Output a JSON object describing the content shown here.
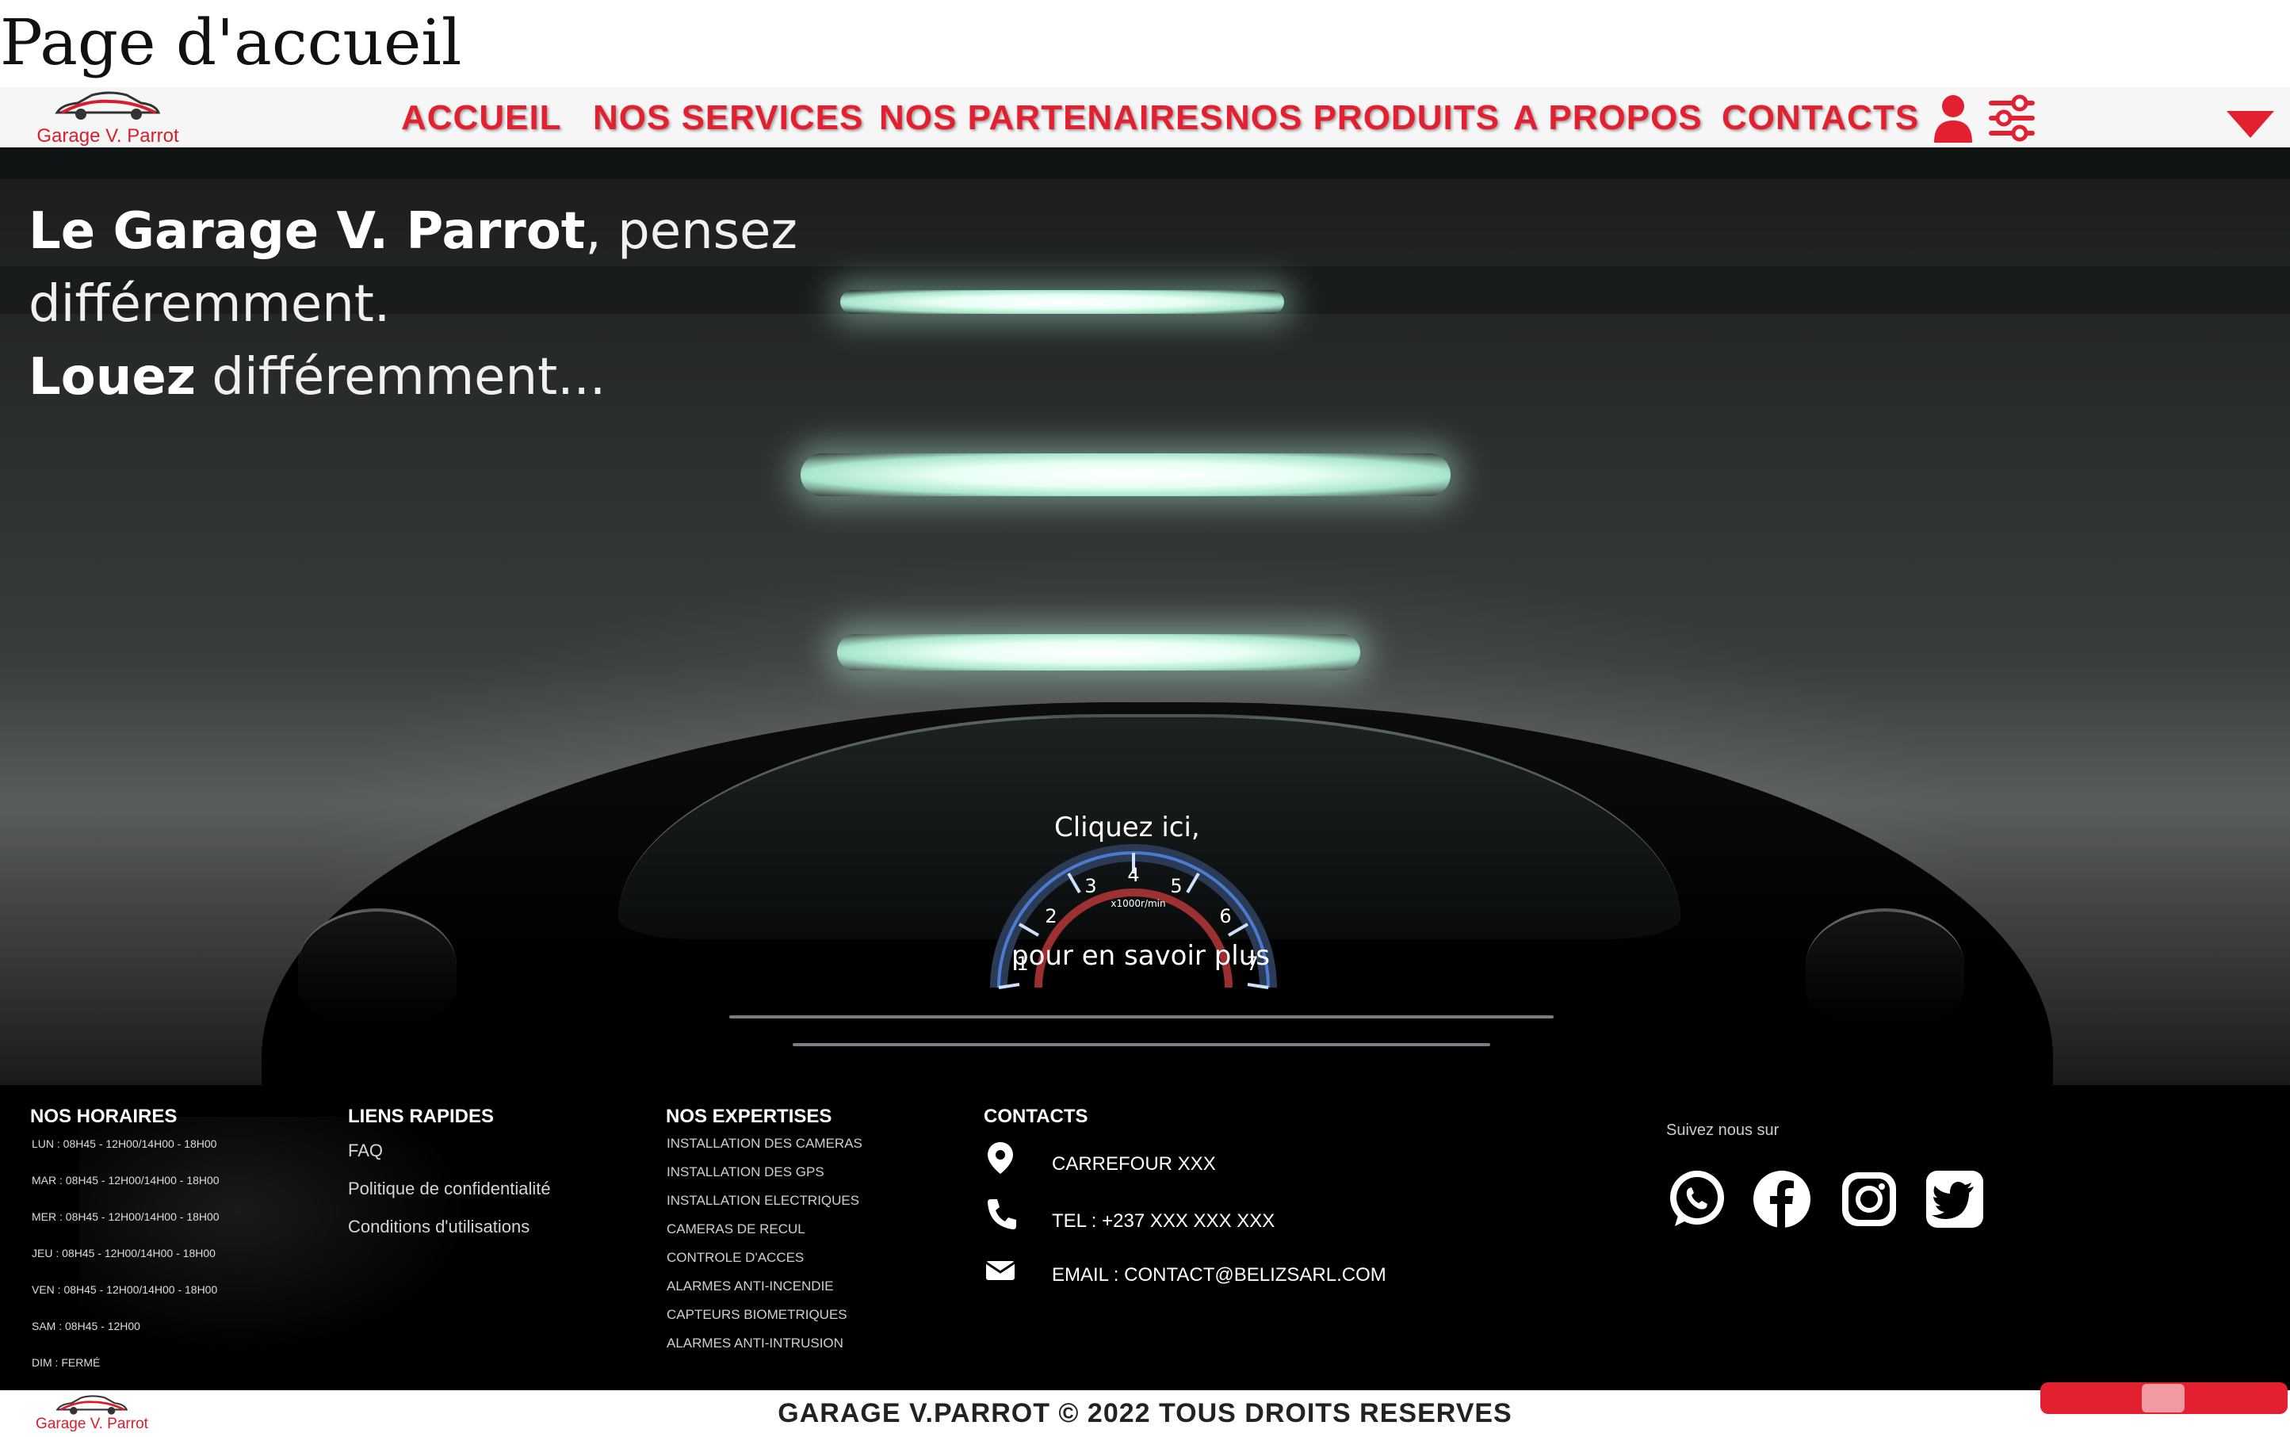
{
  "page_title": "Page d'accueil",
  "brand": {
    "logo_text": "Garage V. Parrot",
    "accent": "#e3202f"
  },
  "nav": {
    "items": [
      {
        "label": "ACCUEIL"
      },
      {
        "label": "NOS SERVICES"
      },
      {
        "label": "NOS PARTENAIRES"
      },
      {
        "label": "NOS PRODUITS"
      },
      {
        "label": "A PROPOS"
      },
      {
        "label": "CONTACTS"
      }
    ],
    "icons": [
      "user-icon",
      "settings-sliders-icon",
      "dropdown-triangle-icon"
    ]
  },
  "hero": {
    "line1_bold": "Le Garage V. Parrot",
    "line1_rest": ", pensez",
    "line2": "différemment.",
    "line3_bold": "Louez",
    "line3_rest": " différemment...",
    "cta_top": "Cliquez ici,",
    "cta_bottom": "pour en savoir plus",
    "gauge_numbers": [
      "1",
      "2",
      "3",
      "4",
      "5",
      "6",
      "7"
    ],
    "gauge_unit": "x1000r/min"
  },
  "footer": {
    "hours": {
      "title": "NOS HORAIRES",
      "rows": [
        "LUN  : 08H45 - 12H00/14H00 - 18H00",
        "MAR : 08H45 - 12H00/14H00 - 18H00",
        "MER : 08H45 - 12H00/14H00 - 18H00",
        "JEU  : 08H45 - 12H00/14H00 - 18H00",
        "VEN  : 08H45 - 12H00/14H00 - 18H00",
        "SAM : 08H45 - 12H00",
        "DIM  : FERMÉ"
      ]
    },
    "quick_links": {
      "title": "LIENS RAPIDES",
      "items": [
        "FAQ",
        "Politique de confidentialité",
        "Conditions d'utilisations"
      ]
    },
    "expertise": {
      "title": "NOS EXPERTISES",
      "items": [
        "INSTALLATION DES CAMERAS",
        "INSTALLATION DES GPS",
        "INSTALLATION ELECTRIQUES",
        "CAMERAS DE RECUL",
        "CONTROLE D'ACCES",
        "ALARMES ANTI-INCENDIE",
        "CAPTEURS BIOMETRIQUES",
        "ALARMES ANTI-INTRUSION"
      ]
    },
    "contacts": {
      "title": "CONTACTS",
      "address": "CARREFOUR XXX",
      "phone": "TEL : +237 XXX XXX XXX",
      "email": "EMAIL : CONTACT@BELIZSARL.COM"
    },
    "social": {
      "label": "Suivez nous sur",
      "networks": [
        "whatsapp-icon",
        "facebook-icon",
        "instagram-icon",
        "twitter-icon"
      ]
    }
  },
  "bottom": {
    "logo_text": "Garage V. Parrot",
    "copyright": "GARAGE V.PARROT © 2022 TOUS DROITS RESERVES"
  }
}
